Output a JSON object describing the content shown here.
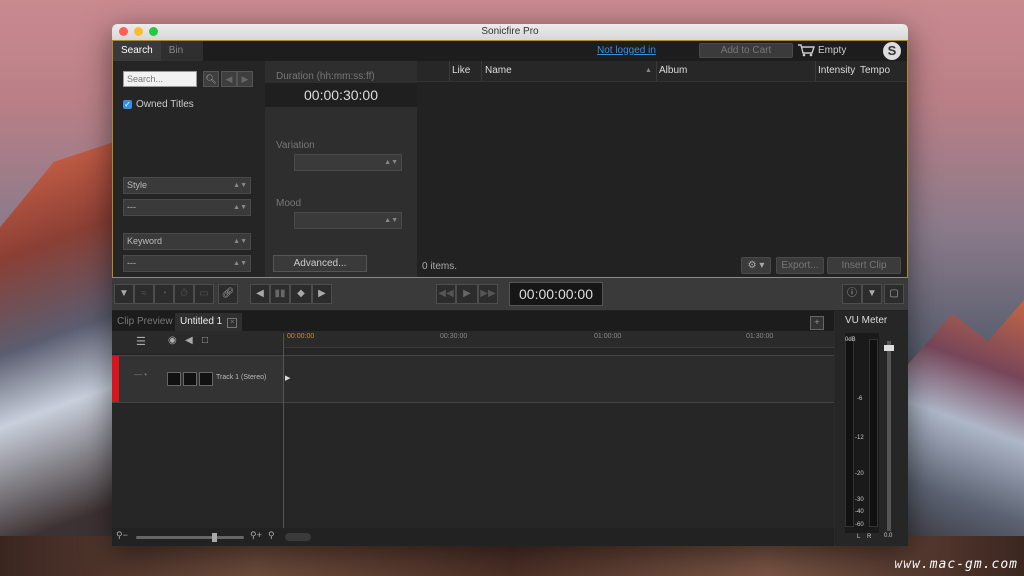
{
  "window": {
    "title": "Sonicfire Pro"
  },
  "tabs": [
    {
      "label": "Search"
    },
    {
      "label": "Bin"
    }
  ],
  "header": {
    "login_link": "Not logged in",
    "add_to_cart": "Add to Cart",
    "cart_status": "Empty"
  },
  "search": {
    "placeholder": "Search...",
    "owned_titles": "Owned Titles",
    "style_label": "Style",
    "style_value": "---",
    "keyword_label": "Keyword",
    "keyword_value": "---"
  },
  "middle": {
    "duration_label": "Duration (hh:mm:ss:ff)",
    "duration_value": "00:00:30:00",
    "variation_label": "Variation",
    "mood_label": "Mood",
    "advanced_button": "Advanced..."
  },
  "list": {
    "columns": [
      "Like",
      "Name",
      "Album",
      "Intensity",
      "Tempo"
    ],
    "items_count": "0 items.",
    "export_button": "Export...",
    "insert_button": "Insert Clip"
  },
  "transport": {
    "timecode": "00:00:00:00"
  },
  "timeline": {
    "tabs": [
      {
        "label": "Clip Preview"
      },
      {
        "label": "Untitled 1"
      }
    ],
    "ruler_ticks": [
      "00:00:00",
      "00:30:00",
      "01:00:00",
      "01:30:00"
    ],
    "track_name": "Track 1 (Stereo)"
  },
  "vu": {
    "title": "VU Meter",
    "scale": [
      "0dB",
      "-6",
      "-12",
      "-20",
      "-30",
      "-40",
      "-60"
    ],
    "channels": [
      "L",
      "R"
    ],
    "fader_value": "0.0"
  },
  "desktop": {
    "watermark": "www.mac-gm.com"
  }
}
